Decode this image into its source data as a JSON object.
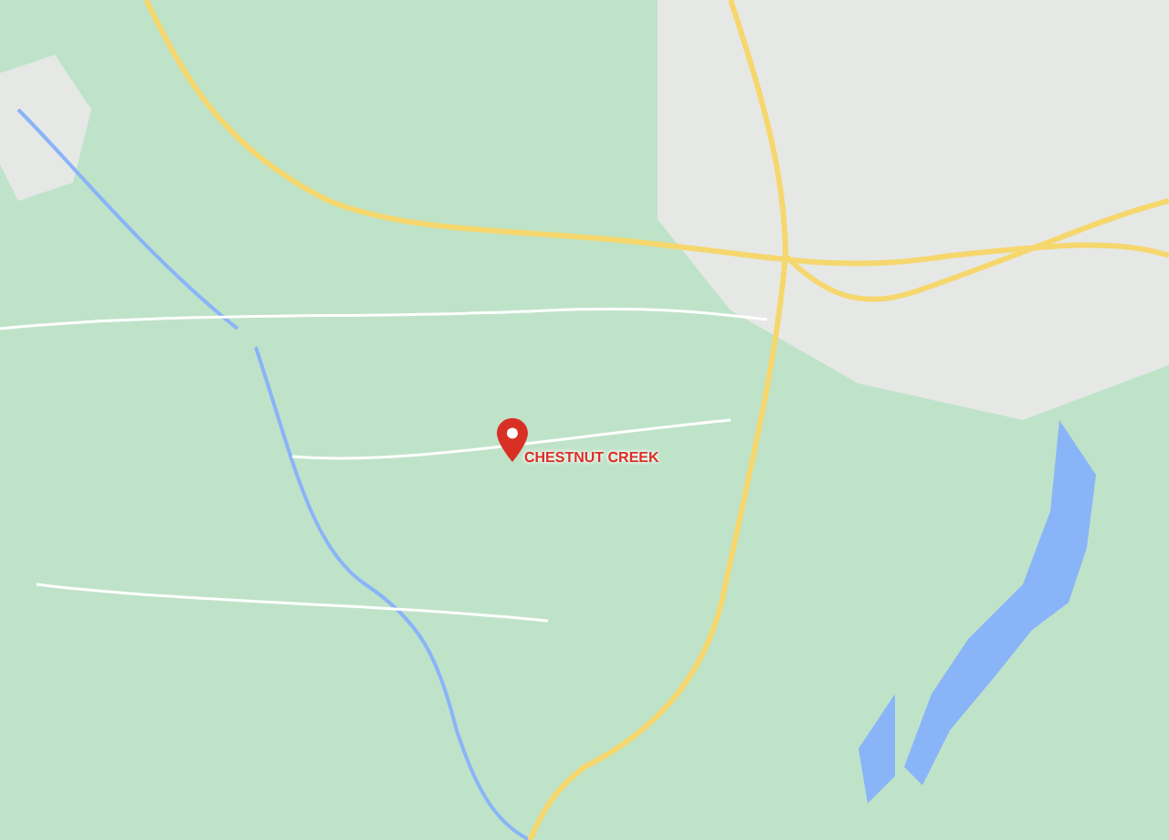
{
  "map": {
    "marker": {
      "label": "CHESTNUT CREEK"
    }
  }
}
